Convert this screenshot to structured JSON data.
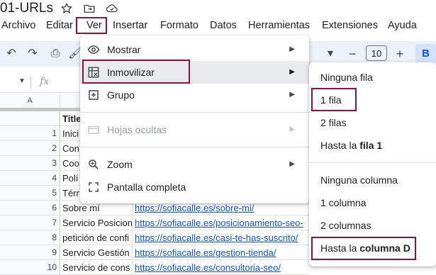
{
  "doc": {
    "title": "01-URLs"
  },
  "menubar": {
    "items": [
      "Archivo",
      "Editar",
      "Ver",
      "Insertar",
      "Formato",
      "Datos",
      "Herramientas",
      "Extensiones",
      "Ayuda"
    ]
  },
  "toolbar": {
    "zoom_value": "10",
    "font_dropdown": "",
    "bold": "B"
  },
  "formula": {
    "fx": "fx"
  },
  "columns": {
    "a": "A"
  },
  "sheet": {
    "header_b": "Title",
    "rows": [
      {
        "num": "1",
        "b": "Inici",
        "c": ""
      },
      {
        "num": "2",
        "b": "Con",
        "c": ""
      },
      {
        "num": "3",
        "b": "Coo",
        "c": ""
      },
      {
        "num": "4",
        "b": "Polí",
        "c": ""
      },
      {
        "num": "5",
        "b": "Térr",
        "c": ""
      },
      {
        "num": "6",
        "b": "Sobre mí",
        "c": "https://sofiacalle.es/sobre-mi/"
      },
      {
        "num": "7",
        "b": "Servicio Posicion",
        "c": "https://sofiacalle.es/posicionamiento-seo-"
      },
      {
        "num": "8",
        "b": "petición de confi",
        "c": "https://sofiacalle.es/casi-te-has-suscrito/"
      },
      {
        "num": "9",
        "b": "Servicio Gestión",
        "c": "https://sofiacalle.es/gestion-tienda/"
      },
      {
        "num": "10",
        "b": "Servicio de cons",
        "c": "https://sofiacalle.es/consultoria-seo/"
      }
    ]
  },
  "ver_menu": {
    "items": [
      {
        "label": "Mostrar",
        "icon": "eye-icon"
      },
      {
        "label": "Inmovilizar",
        "icon": "freeze-icon"
      },
      {
        "label": "Grupo",
        "icon": "plus-box-icon"
      },
      {
        "label": "Hojas ocultas",
        "icon": "hidden-sheets-icon"
      },
      {
        "label": "Zoom",
        "icon": "zoom-icon"
      },
      {
        "label": "Pantalla completa",
        "icon": "fullscreen-icon"
      }
    ]
  },
  "freeze_submenu": {
    "ninguna_fila": "Ninguna fila",
    "una_fila": "1 fila",
    "dos_filas": "2 filas",
    "hasta_fila_prefix": "Hasta la ",
    "hasta_fila_bold": "fila 1",
    "ninguna_columna": "Ninguna columna",
    "una_columna": "1 columna",
    "dos_columnas": "2 columnas",
    "hasta_columna_prefix": "Hasta la ",
    "hasta_columna_bold": "columna D"
  },
  "colors": {
    "highlight": "#8a1538",
    "link": "#1155cc",
    "toolbar_bg": "#edf2fa"
  }
}
